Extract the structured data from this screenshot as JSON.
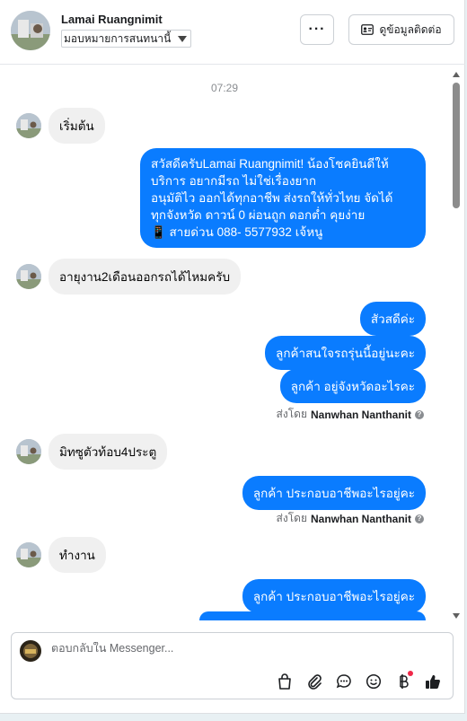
{
  "header": {
    "contact_name": "Lamai Ruangnimit",
    "assign_select": "มอบหมายการสนทนานี้",
    "more_label": "···",
    "info_button": "ดูข้อมูลติดต่อ"
  },
  "conversation": {
    "timestamp": "07:29",
    "m1": "เริ่มต้น",
    "m2_lines": [
      "สวัสดีครับLamai Ruangnimit! น้องโชคยินดีให้",
      "บริการ อยากมีรถ ไม่ใช่เรื่องยาก",
      "อนุมัติไว ออกได้ทุกอาชีพ ส่งรถให้ทั่วไทย จัดได้",
      "ทุกจังหวัด ดาวน์ 0  ผ่อนถูก ดอกต่ำ คุยง่าย",
      "📱 สายด่วน 088- 5577932 เจ้หนู"
    ],
    "m3": "อายุงาน2เดือนออกรถได้ไหมครับ",
    "m4": "สัวสดีค่ะ",
    "m5": "ลูกค้าสนใจรถรุ่นนี้อยู่นะคะ",
    "m6": "ลูกค้า อยู่จังหวัดอะไรคะ",
    "sent_prefix": "ส่งโดย",
    "sender": "Nanwhan Nanthanit",
    "m7": "มิทซูตัวท้อบ4ประตู",
    "m8": "ลูกค้า ประกอบอาชีพอะไรอยู่คะ",
    "m9": "ทำงาน",
    "m10": "ลูกค้า ประกอบอาชีพอะไรอยู่คะ"
  },
  "composer": {
    "placeholder": "ตอบกลับใน Messenger..."
  },
  "icons": [
    "bag-icon",
    "paperclip-icon",
    "chat-icon",
    "emoji-icon",
    "baht-icon",
    "thumbs-up-icon"
  ],
  "colors": {
    "outgoing_bubble": "#0a7cff",
    "incoming_bubble": "#f0f0f0",
    "notification_dot": "#f02849"
  }
}
